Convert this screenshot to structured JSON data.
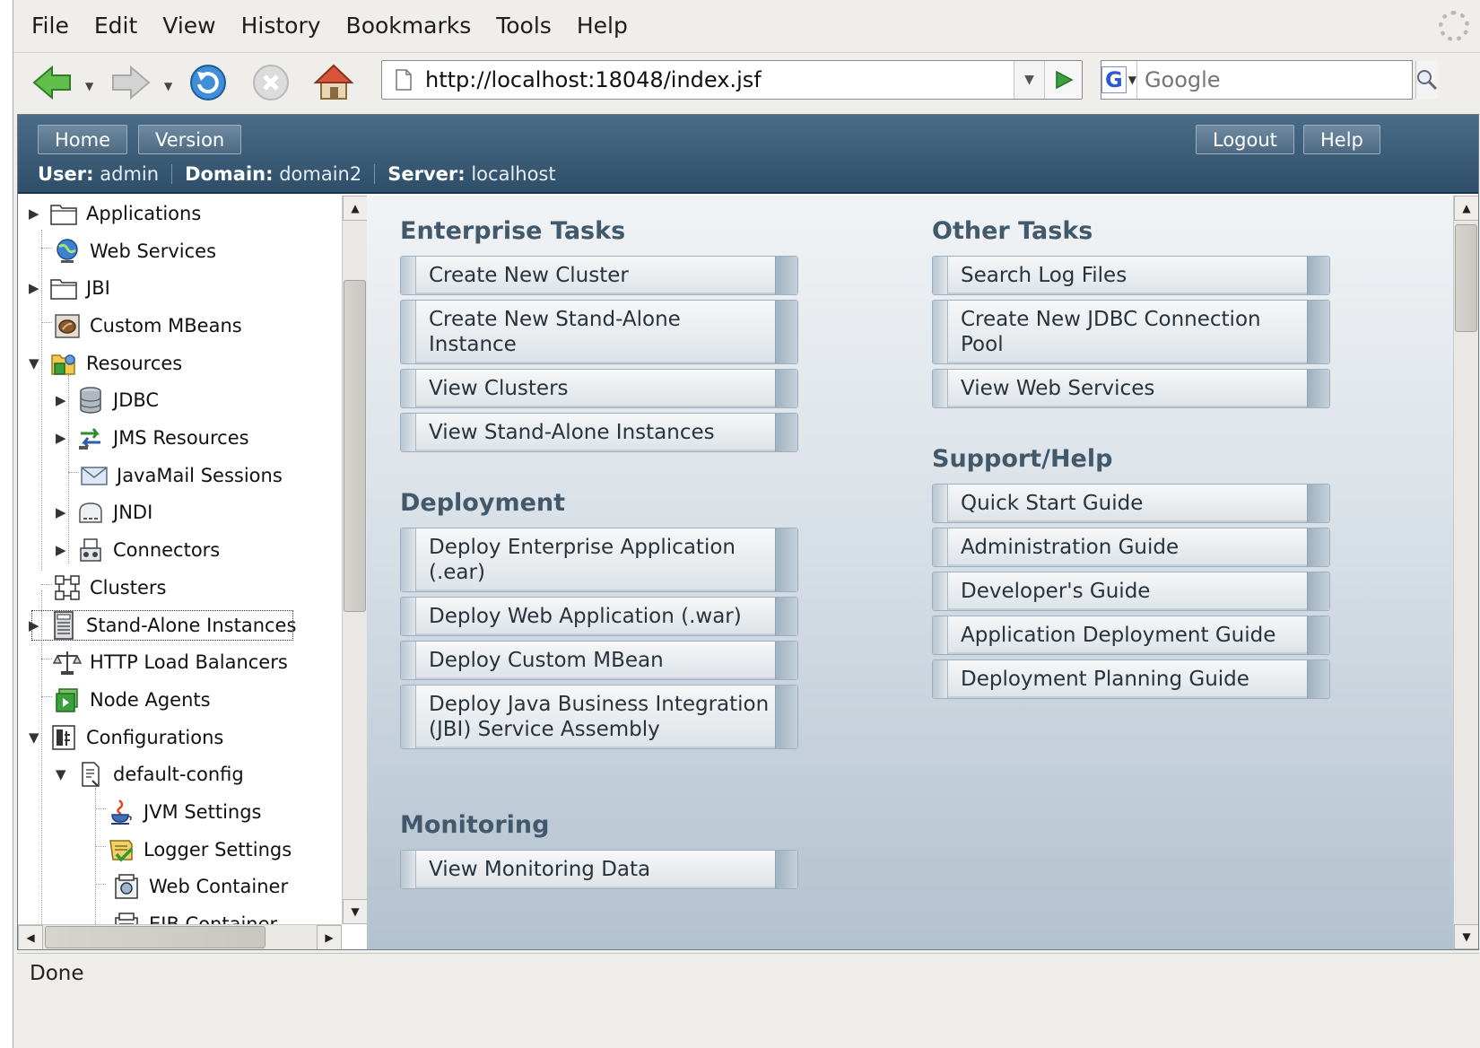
{
  "menubar": {
    "items": [
      "File",
      "Edit",
      "View",
      "History",
      "Bookmarks",
      "Tools",
      "Help"
    ]
  },
  "toolbar": {
    "url": "http://localhost:18048/index.jsf",
    "search_placeholder": "Google",
    "search_engine_letter": "G"
  },
  "masthead": {
    "home_label": "Home",
    "version_label": "Version",
    "logout_label": "Logout",
    "help_label": "Help",
    "user_label": "User:",
    "user_value": "admin",
    "domain_label": "Domain:",
    "domain_value": "domain2",
    "server_label": "Server:",
    "server_value": "localhost"
  },
  "tree": {
    "items": [
      {
        "label": "Applications",
        "icon": "folder-icon"
      },
      {
        "label": "Web Services",
        "icon": "globe-icon"
      },
      {
        "label": "JBI",
        "icon": "folder-icon"
      },
      {
        "label": "Custom MBeans",
        "icon": "bean-icon"
      },
      {
        "label": "Resources",
        "icon": "resources-icon"
      },
      {
        "label": "JDBC",
        "icon": "database-icon"
      },
      {
        "label": "JMS Resources",
        "icon": "exchange-icon"
      },
      {
        "label": "JavaMail Sessions",
        "icon": "envelope-icon"
      },
      {
        "label": "JNDI",
        "icon": "jndi-icon"
      },
      {
        "label": "Connectors",
        "icon": "connector-icon"
      },
      {
        "label": "Clusters",
        "icon": "cluster-icon"
      },
      {
        "label": "Stand-Alone Instances",
        "icon": "instance-icon"
      },
      {
        "label": "HTTP Load Balancers",
        "icon": "balancer-icon"
      },
      {
        "label": "Node Agents",
        "icon": "agent-icon"
      },
      {
        "label": "Configurations",
        "icon": "config-icon"
      },
      {
        "label": "default-config",
        "icon": "document-icon"
      },
      {
        "label": "JVM Settings",
        "icon": "java-icon"
      },
      {
        "label": "Logger Settings",
        "icon": "logger-icon"
      },
      {
        "label": "Web Container",
        "icon": "container-icon"
      },
      {
        "label": "EJB Container",
        "icon": "ejb-icon"
      }
    ]
  },
  "sections": {
    "enterprise": {
      "title": "Enterprise Tasks",
      "items": [
        "Create New Cluster",
        "Create New Stand-Alone Instance",
        "View Clusters",
        "View Stand-Alone Instances"
      ]
    },
    "deployment": {
      "title": "Deployment",
      "items": [
        "Deploy Enterprise Application (.ear)",
        "Deploy Web Application (.war)",
        "Deploy Custom MBean",
        "Deploy Java Business Integration (JBI) Service Assembly"
      ]
    },
    "monitoring": {
      "title": "Monitoring",
      "items": [
        "View Monitoring Data"
      ]
    },
    "other": {
      "title": "Other Tasks",
      "items": [
        "Search Log Files",
        "Create New JDBC Connection Pool",
        "View Web Services"
      ]
    },
    "support": {
      "title": "Support/Help",
      "items": [
        "Quick Start Guide",
        "Administration Guide",
        "Developer's Guide",
        "Application Deployment Guide",
        "Deployment Planning Guide"
      ]
    }
  },
  "status": {
    "text": "Done"
  },
  "colors": {
    "masthead": "#3b5b76",
    "section_title": "#42596c",
    "accent_green": "#3ca13c"
  }
}
